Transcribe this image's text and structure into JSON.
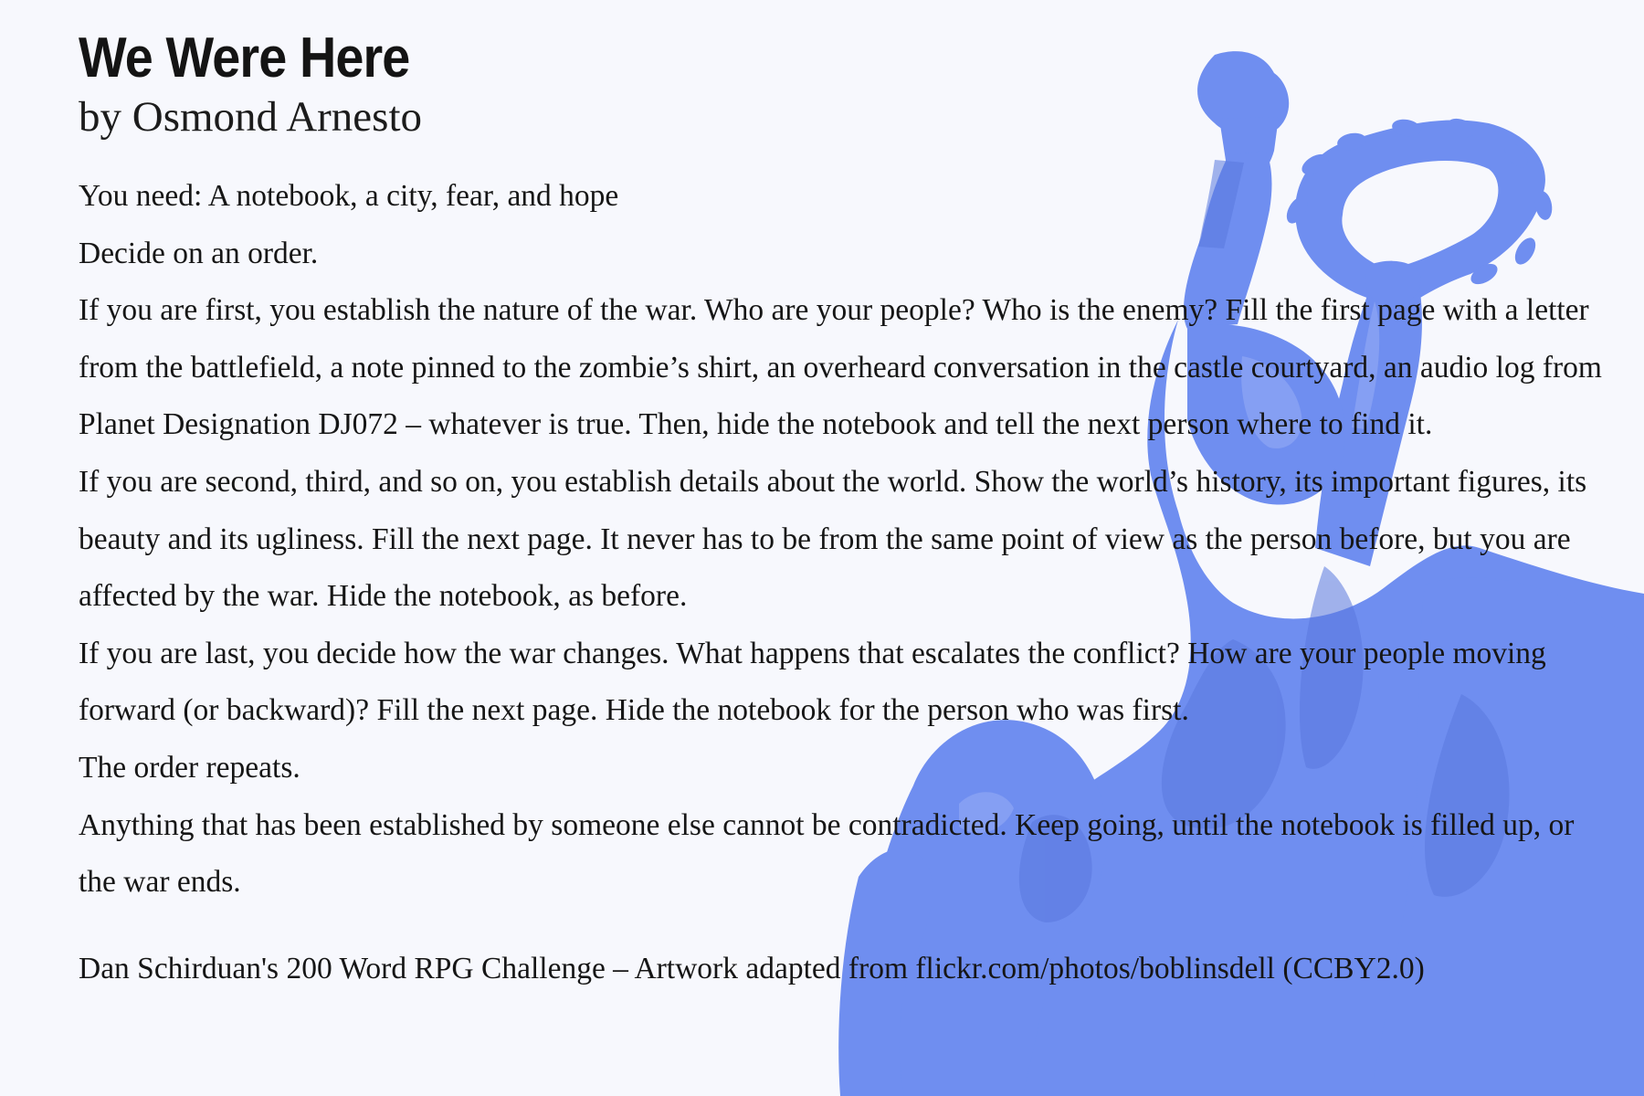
{
  "document": {
    "title": "We Were Here",
    "byline": "by Osmond Arnesto",
    "paragraphs": [
      "You need: A notebook, a city, fear, and hope",
      "Decide on an order.",
      "If you are first, you establish the nature of the war. Who are your people? Who is the enemy? Fill the first page with a letter from the battlefield, a note pinned to the zombie’s shirt, an overheard conversation in the castle courtyard, an audio log from Planet Designation DJ072 – whatever is true. Then, hide the notebook and tell the next person where to find it.",
      "If you are second, third, and so on, you establish details about the world. Show the world’s history, its important figures, its beauty and its ugliness. Fill the next page. It never has to be from the same point of view as the person before, but you are affected by the war. Hide the notebook, as before.",
      "If you are last, you decide how the war changes. What happens that escalates the conflict? How are your people moving forward (or backward)? Fill the next page. Hide the notebook for the person who was first.",
      "The order repeats.",
      "Anything that has been established by someone else cannot be contradicted. Keep going, until the notebook is filled up, or the war ends."
    ],
    "credit": "Dan Schirduan's 200 Word RPG Challenge – Artwork adapted from flickr.com/photos/boblinsdell (CCBY2.0)"
  },
  "colors": {
    "background": "#f7f8fd",
    "statue": "#6f8ef0",
    "text": "#161616"
  }
}
